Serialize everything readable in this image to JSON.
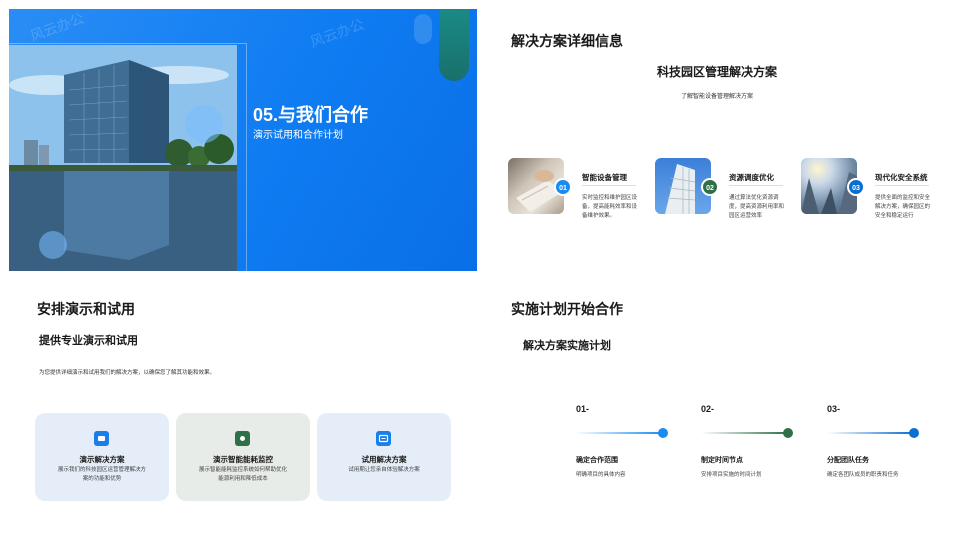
{
  "slide1": {
    "title": "05.与我们合作",
    "subtitle": "演示试用和合作计划",
    "watermark": "风云办公",
    "colors": {
      "background": "#0f7cf2",
      "accent_pill": "#1c8c7a"
    }
  },
  "slide2": {
    "heading": "解决方案详细信息",
    "center_title": "科技园区管理解决方案",
    "center_subtitle": "了解智能设备管理解决方案",
    "cards": [
      {
        "number": "01",
        "title": "智能设备管理",
        "desc": "实时监控和维护园区设备，提高能耗效率和设备维护效果。",
        "color": "#1a8cf0",
        "image": "document-photo"
      },
      {
        "number": "02",
        "title": "资源调度优化",
        "desc": "通过算法优化资源调度，提高资源利用率和园区运营效率",
        "color": "#2e7048",
        "image": "building-photo"
      },
      {
        "number": "03",
        "title": "现代化安全系统",
        "desc": "提供全面的监控和安全解决方案，确保园区的安全和稳定运行",
        "color": "#0b6fd0",
        "image": "skyscraper-photo"
      }
    ]
  },
  "slide3": {
    "heading": "安排演示和试用",
    "subheading": "提供专业演示和试用",
    "intro": "为您提供详细演示和试用我们的解决方案，以确保您了解其功能和效果。",
    "boxes": [
      {
        "title": "演示解决方案",
        "desc": "展示我们的科技园区运营管理解决方案的功能和优势",
        "bg": "#e5eef8",
        "icon_color": "#1a7fe8",
        "icon": "presentation-icon"
      },
      {
        "title": "演示智能能耗监控",
        "desc": "展示智能能耗监控系统如何帮助优化能源利用和降低成本",
        "bg": "#e8ece9",
        "icon_color": "#2e7048",
        "icon": "monitor-icon"
      },
      {
        "title": "试用解决方案",
        "desc": "试用期让您亲自体验解决方案",
        "bg": "#e5eef8",
        "icon_color": "#1a7fe8",
        "icon": "trial-icon"
      }
    ]
  },
  "slide4": {
    "heading": "实施计划开始合作",
    "subheading": "解决方案实施计划",
    "steps": [
      {
        "number": "01-",
        "title": "确定合作范围",
        "desc": "明确项目的具体内容",
        "color": "#1a8cf0"
      },
      {
        "number": "02-",
        "title": "制定时间节点",
        "desc": "安排项目实施的时间计划",
        "color": "#2e7048"
      },
      {
        "number": "03-",
        "title": "分配团队任务",
        "desc": "确定各团队成员的职责和任务",
        "color": "#0b6fd0"
      }
    ]
  }
}
